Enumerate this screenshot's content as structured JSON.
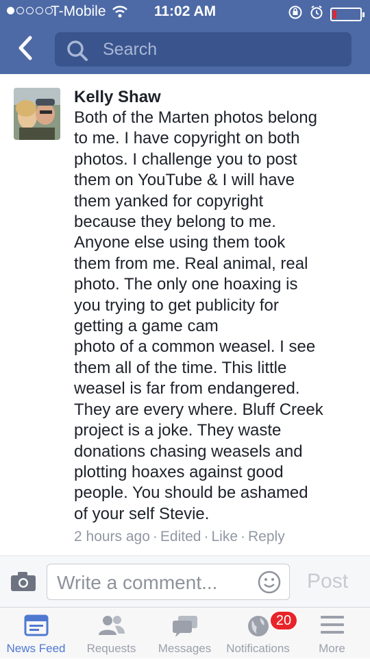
{
  "status_bar": {
    "carrier": "T-Mobile",
    "time": "11:02 AM"
  },
  "nav": {
    "search_placeholder": "Search"
  },
  "post": {
    "author": "Kelly Shaw",
    "text": "Both of the Marten photos belong\nto me. I have copyright on both\nphotos. I challenge you to post\nthem on YouTube & I will have\nthem yanked for copyright\nbecause they belong to me.\nAnyone else using them took\nthem from me. Real animal, real\nphoto. The only one hoaxing is\nyou trying to get publicity for\ngetting a game cam\nphoto of a common weasel. I see\nthem all of the time. This little\nweasel is far from endangered.\nThey are every where. Bluff Creek\nproject is a joke. They waste\ndonations chasing weasels and\nplotting hoaxes against good\npeople. You should be ashamed\nof your self Stevie.",
    "timestamp": "2 hours ago",
    "edited": "Edited",
    "like": "Like",
    "reply": "Reply",
    "separator": "·"
  },
  "composer": {
    "placeholder": "Write a comment...",
    "post_label": "Post"
  },
  "tabbar": {
    "tabs": [
      {
        "label": "News Feed",
        "icon": "news-feed-icon",
        "active": true
      },
      {
        "label": "Requests",
        "icon": "friends-icon",
        "active": false
      },
      {
        "label": "Messages",
        "icon": "messages-icon",
        "active": false
      },
      {
        "label": "Notifications",
        "icon": "globe-icon",
        "active": false
      },
      {
        "label": "More",
        "icon": "menu-icon",
        "active": false
      }
    ],
    "notifications_badge": "20"
  },
  "colors": {
    "header": "#4d6aa6",
    "active_tab": "#4f79d1",
    "badge": "#e8242a"
  }
}
